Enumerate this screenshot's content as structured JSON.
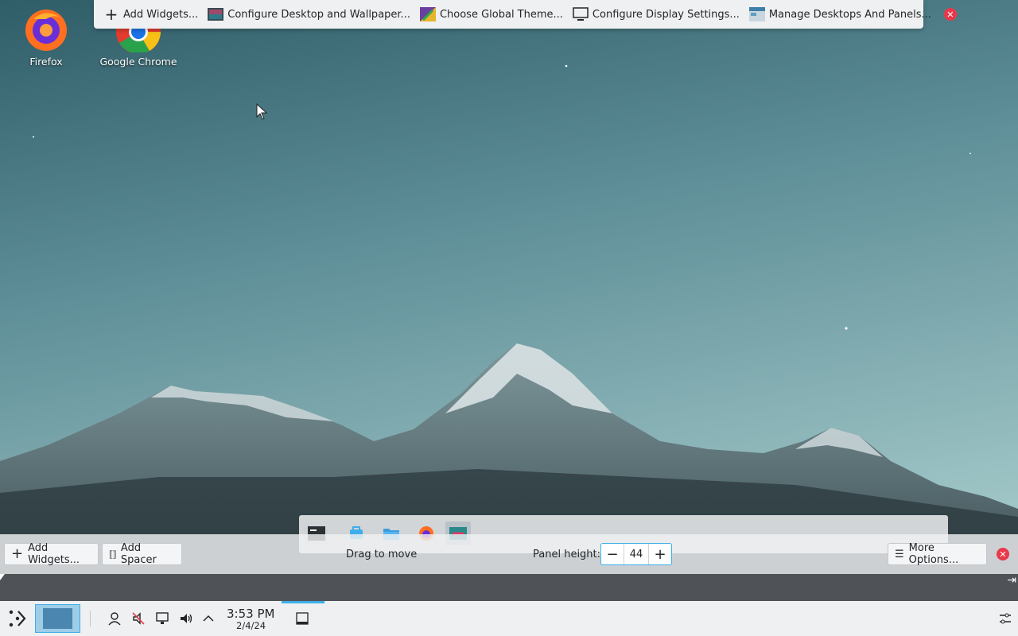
{
  "desktop": {
    "icons": [
      {
        "label": "Firefox",
        "icon": "firefox-icon"
      },
      {
        "label": "Google Chrome",
        "icon": "chrome-icon"
      }
    ]
  },
  "top_toolbar": {
    "add_widgets": "Add Widgets...",
    "configure_desktop": "Configure Desktop and Wallpaper...",
    "choose_theme": "Choose Global Theme...",
    "display_settings": "Configure Display Settings...",
    "manage_desktops": "Manage Desktops And Panels..."
  },
  "panel_config": {
    "add_widgets": "Add Widgets...",
    "add_spacer": "Add Spacer",
    "drag_to_move": "Drag to move",
    "panel_height_label": "Panel height:",
    "panel_height_value": "44",
    "more_options": "More Options..."
  },
  "panel": {
    "clock_time": "3:53 PM",
    "clock_date": "2/4/24"
  },
  "colors": {
    "accent": "#3daee9",
    "close": "#e8394a",
    "panel_bg": "#eff0f1"
  }
}
